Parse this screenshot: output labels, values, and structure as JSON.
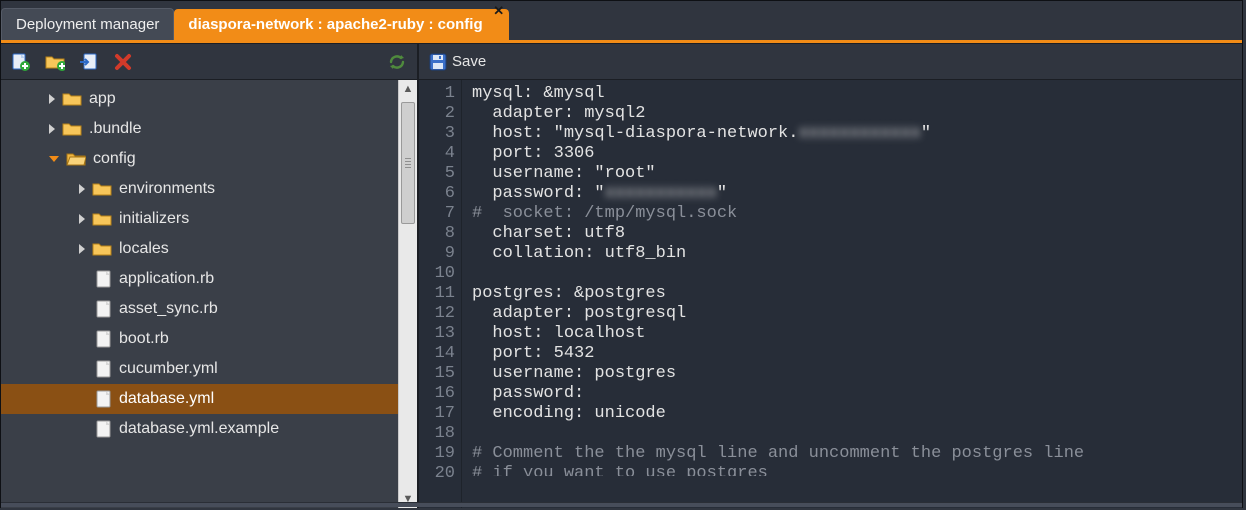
{
  "tabs": {
    "inactive_label": "Deployment manager",
    "active_label": "diaspora-network : apache2-ruby : config"
  },
  "toolbar": {
    "new_file": "new-file",
    "new_folder": "new-folder",
    "import": "import",
    "delete": "delete",
    "refresh": "refresh",
    "save_label": "Save"
  },
  "tree": {
    "items": [
      {
        "type": "folder",
        "state": "closed",
        "arrow": "right",
        "indent": 48,
        "label": "app"
      },
      {
        "type": "folder",
        "state": "closed",
        "arrow": "right",
        "indent": 48,
        "label": ".bundle"
      },
      {
        "type": "folder",
        "state": "open",
        "arrow": "down",
        "indent": 48,
        "label": "config"
      },
      {
        "type": "folder",
        "state": "closed",
        "arrow": "right",
        "indent": 78,
        "label": "environments"
      },
      {
        "type": "folder",
        "state": "closed",
        "arrow": "right",
        "indent": 78,
        "label": "initializers"
      },
      {
        "type": "folder",
        "state": "closed",
        "arrow": "right",
        "indent": 78,
        "label": "locales"
      },
      {
        "type": "file",
        "indent": 95,
        "label": "application.rb"
      },
      {
        "type": "file",
        "indent": 95,
        "label": "asset_sync.rb"
      },
      {
        "type": "file",
        "indent": 95,
        "label": "boot.rb"
      },
      {
        "type": "file",
        "indent": 95,
        "label": "cucumber.yml"
      },
      {
        "type": "file",
        "indent": 95,
        "label": "database.yml",
        "selected": true
      },
      {
        "type": "file",
        "indent": 95,
        "label": "database.yml.example"
      }
    ]
  },
  "editor": {
    "lines": [
      {
        "n": 1,
        "text": "mysql: &mysql"
      },
      {
        "n": 2,
        "text": "  adapter: mysql2"
      },
      {
        "n": 3,
        "text": "  host: \"mysql-diaspora-network.",
        "blurred_tail": "xxxxxxxxxxxx",
        "tail_after": "\""
      },
      {
        "n": 4,
        "text": "  port: 3306"
      },
      {
        "n": 5,
        "text": "  username: \"root\""
      },
      {
        "n": 6,
        "text": "  password: \"",
        "blurred_tail": "xxxxxxxxxxx",
        "tail_after": "\""
      },
      {
        "n": 7,
        "text": "#  socket: /tmp/mysql.sock",
        "comment": true
      },
      {
        "n": 8,
        "text": "  charset: utf8"
      },
      {
        "n": 9,
        "text": "  collation: utf8_bin"
      },
      {
        "n": 10,
        "text": ""
      },
      {
        "n": 11,
        "text": "postgres: &postgres"
      },
      {
        "n": 12,
        "text": "  adapter: postgresql"
      },
      {
        "n": 13,
        "text": "  host: localhost"
      },
      {
        "n": 14,
        "text": "  port: 5432"
      },
      {
        "n": 15,
        "text": "  username: postgres"
      },
      {
        "n": 16,
        "text": "  password:"
      },
      {
        "n": 17,
        "text": "  encoding: unicode"
      },
      {
        "n": 18,
        "text": ""
      },
      {
        "n": 19,
        "text": "# Comment the the mysql line and uncomment the postgres line",
        "comment": true
      },
      {
        "n": 20,
        "text": "# if you want to use postgres",
        "comment": true,
        "cut": true
      }
    ]
  },
  "colors": {
    "accent": "#f28c17"
  }
}
